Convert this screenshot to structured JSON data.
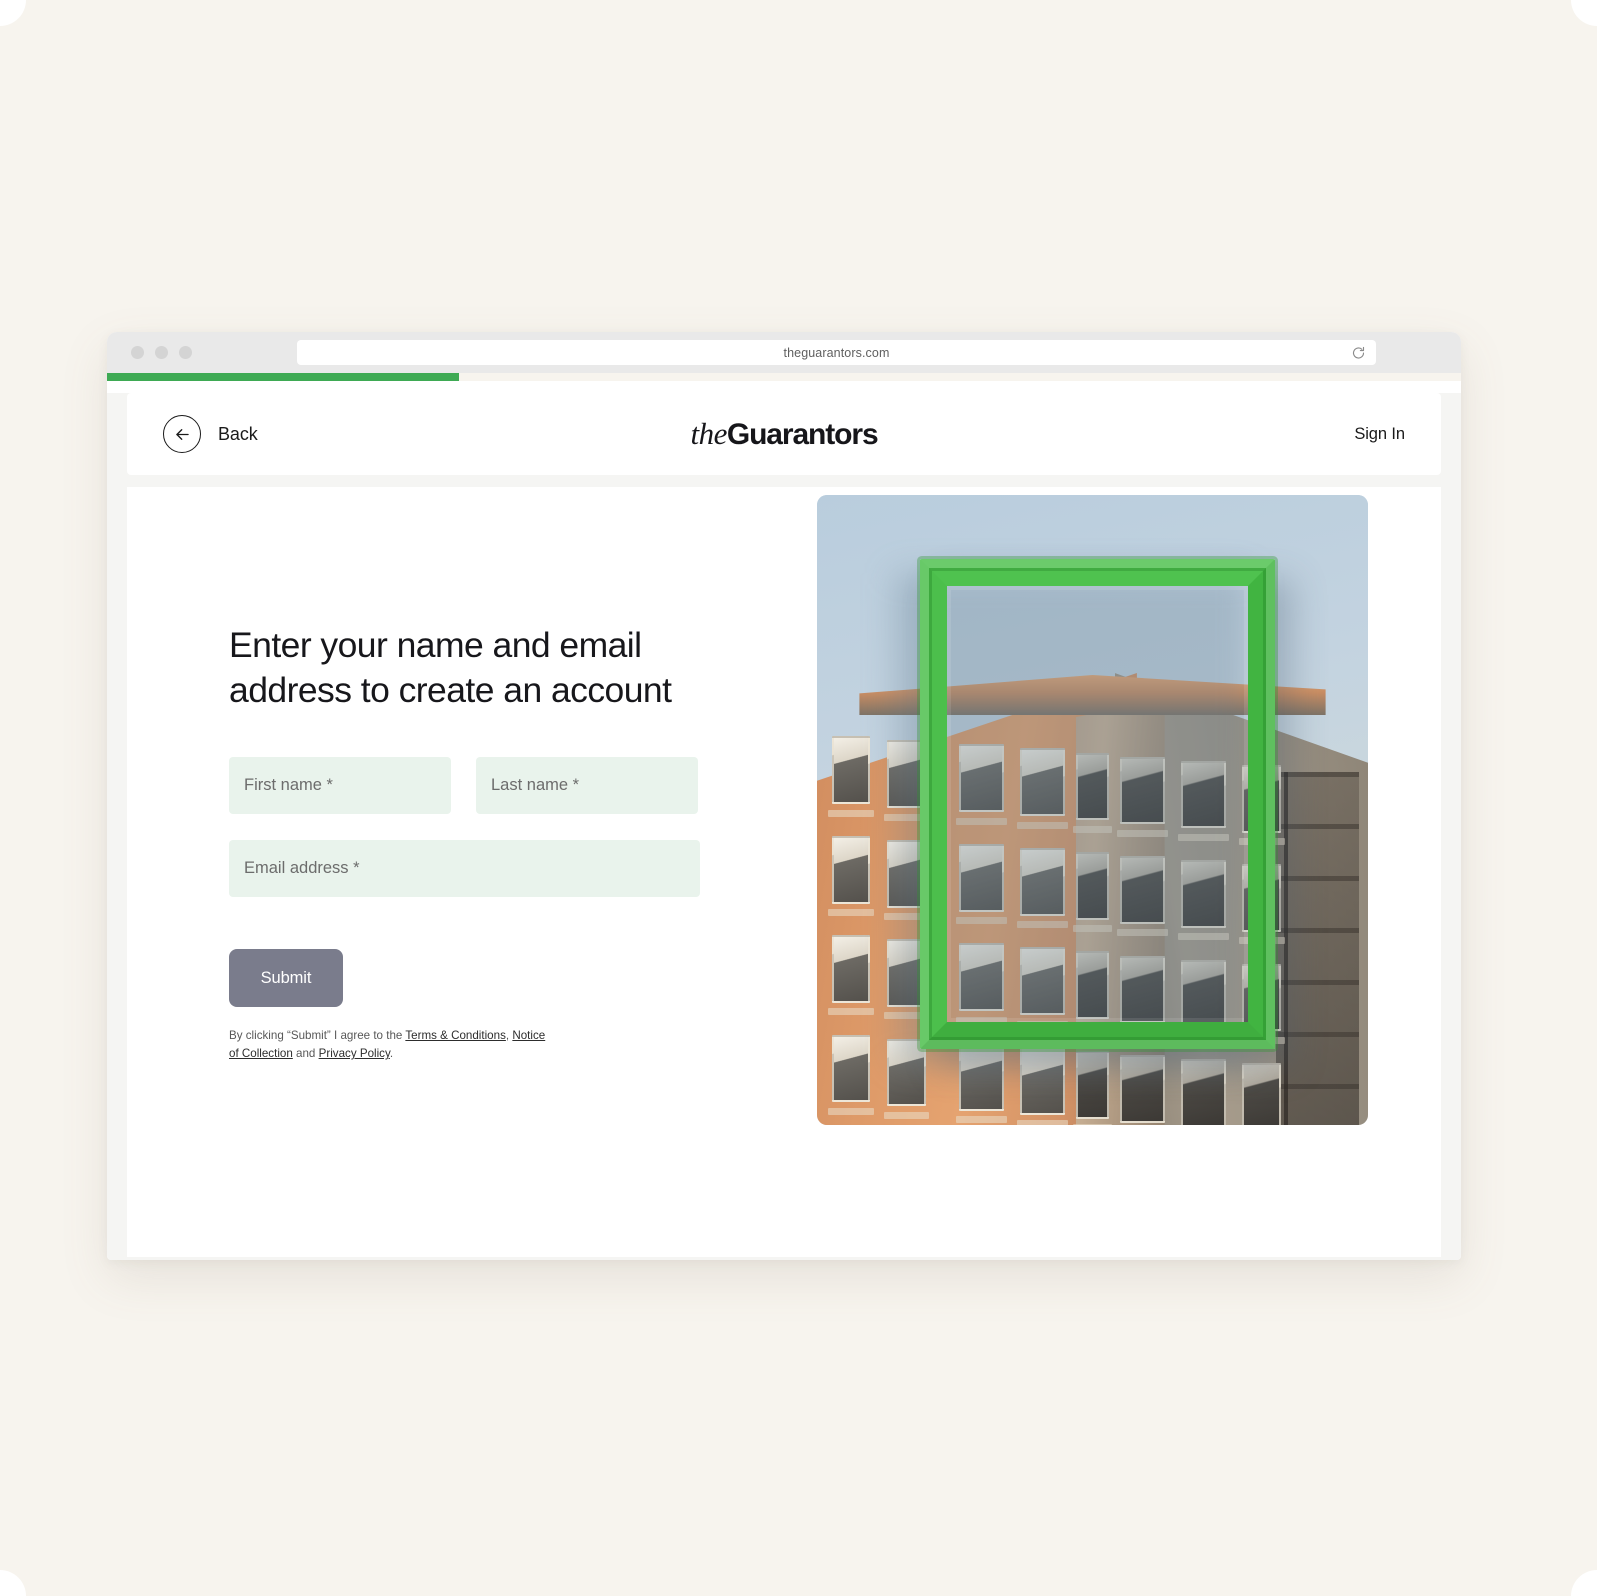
{
  "browser": {
    "url": "theguarantors.com",
    "reload_icon": "reload-icon",
    "traffic_lights": [
      "dot",
      "dot",
      "dot"
    ],
    "progress_percent": 26,
    "progress_color": "#3eaa54"
  },
  "header": {
    "back_label": "Back",
    "back_icon": "arrow-left-icon",
    "logo_prefix": "the",
    "logo_name": "Guarantors",
    "signin_label": "Sign In"
  },
  "main": {
    "headline": "Enter your name and email address to create an account",
    "fields": {
      "first_name_placeholder": "First name *",
      "last_name_placeholder": "Last name *",
      "email_placeholder": "Email address *",
      "first_name_value": "",
      "last_name_value": "",
      "email_value": ""
    },
    "submit_label": "Submit",
    "legal": {
      "intro": "By clicking “Submit” I agree to the ",
      "terms_link": "Terms & Conditions",
      "after_terms": ", ",
      "notice_link": "Notice of Collection",
      "conjunction": " and ",
      "privacy_link": "Privacy Policy",
      "period": "."
    }
  },
  "hero": {
    "alt": "green picture frame in front of a sunlit victorian corner building",
    "frame_color": "#45b845",
    "sky_color": "#c4d4e0",
    "building_warm_color": "#e09c6b",
    "building_shade_color": "#9a9183"
  },
  "theme": {
    "page_background": "#f7f4ee",
    "field_background": "#e9f3ec",
    "submit_background": "#7a7c8c",
    "accent_green": "#3eaa54"
  }
}
